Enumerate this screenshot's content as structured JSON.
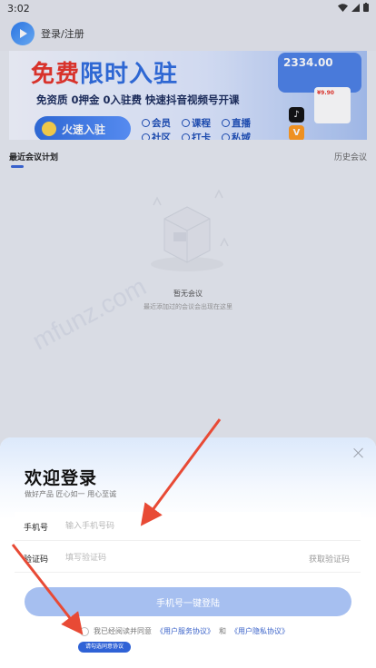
{
  "status_bar": {
    "time": "3:02"
  },
  "header": {
    "title": "登录/注册"
  },
  "banner": {
    "title_red": "免费",
    "title_blue": "限时入驻",
    "subtitle": "免资质  0押金  0入驻费  快速抖音视频号开课",
    "cta": "火速入驻",
    "features": [
      "会员",
      "课程",
      "直播",
      "社区",
      "打卡",
      "私域"
    ],
    "card_amount": "2334.00",
    "mini_price": "¥9.90",
    "app_tiktok": "♪",
    "app_v": "V"
  },
  "tabs": {
    "recent": "最近会议计划",
    "history": "历史会议"
  },
  "empty": {
    "title": "暂无会议",
    "subtitle": "最近添加过的会议会出现在这里"
  },
  "watermark": "mfunz.com",
  "login": {
    "title": "欢迎登录",
    "slogan": "做好产品 匠心如一 用心至诚",
    "phone_label": "手机号",
    "phone_placeholder": "输入手机号码",
    "code_label": "验证码",
    "code_placeholder": "填写验证码",
    "get_code": "获取验证码",
    "login_button": "手机号一键登陆",
    "agree_prefix": "我已经阅读并同意",
    "service_link": "《用户服务协议》",
    "and": "和",
    "privacy_link": "《用户隐私协议》",
    "tip": "请勾选同意协议"
  },
  "colors": {
    "accent": "#3a66d8",
    "button": "#a6bff0",
    "arrow": "#e84a35"
  }
}
